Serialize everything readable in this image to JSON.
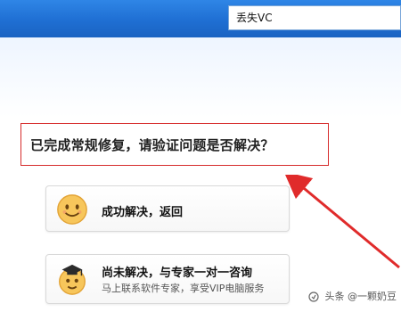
{
  "header": {
    "search_value": "丢失VC"
  },
  "question": {
    "text": "已完成常规修复，请验证问题是否解决？"
  },
  "options": [
    {
      "title": "成功解决，返回",
      "icon": "smile-face-icon"
    },
    {
      "title": "尚未解决，与专家一对一咨询",
      "subtitle": "马上联系软件专家，享受VIP电脑服务",
      "icon": "expert-face-icon"
    }
  ],
  "annotation": {
    "arrow_color": "#e02b2b"
  },
  "watermark": {
    "text": "头条 @一颗奶豆"
  },
  "colors": {
    "header_blue": "#1f6fd3",
    "highlight_red": "#d62b2b"
  }
}
